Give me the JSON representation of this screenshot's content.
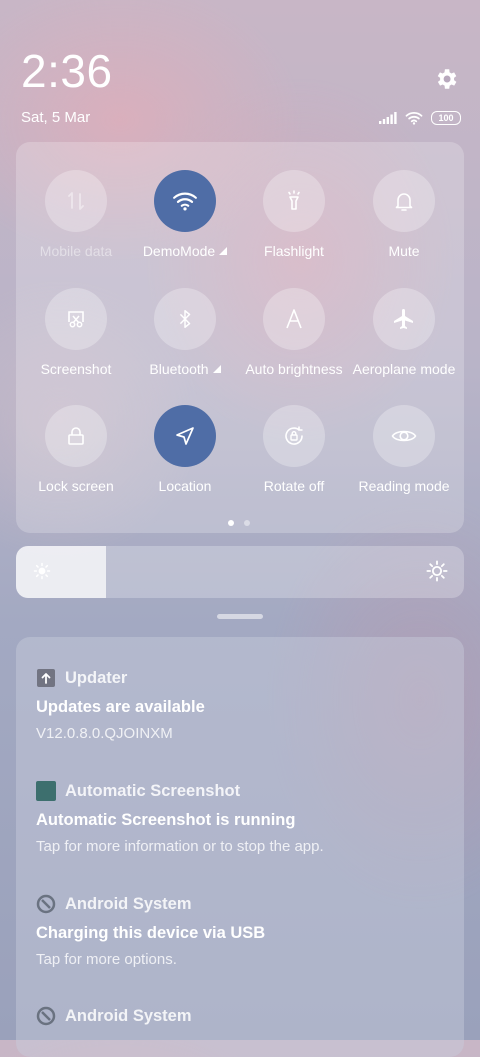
{
  "status_bar": {
    "time": "2:36",
    "date": "Sat, 5 Mar",
    "battery": "100",
    "icons": [
      "signal-icon",
      "wifi-icon",
      "battery-icon"
    ]
  },
  "quick_settings": {
    "tiles": [
      {
        "label": "Mobile data",
        "icon": "mobile-data-icon",
        "state": "disabled"
      },
      {
        "label": "DemoMode",
        "icon": "wifi-icon",
        "state": "active",
        "expandable": true
      },
      {
        "label": "Flashlight",
        "icon": "flashlight-icon",
        "state": "off"
      },
      {
        "label": "Mute",
        "icon": "bell-icon",
        "state": "off"
      },
      {
        "label": "Screenshot",
        "icon": "screenshot-icon",
        "state": "off"
      },
      {
        "label": "Bluetooth",
        "icon": "bluetooth-icon",
        "state": "off",
        "expandable": true
      },
      {
        "label": "Auto brightness",
        "icon": "auto-brightness-icon",
        "state": "off"
      },
      {
        "label": "Aeroplane mode",
        "icon": "airplane-icon",
        "state": "off"
      },
      {
        "label": "Lock screen",
        "icon": "lock-icon",
        "state": "off"
      },
      {
        "label": "Location",
        "icon": "location-icon",
        "state": "active"
      },
      {
        "label": "Rotate off",
        "icon": "rotate-lock-icon",
        "state": "off"
      },
      {
        "label": "Reading mode",
        "icon": "eye-icon",
        "state": "off"
      }
    ],
    "page_count": 2,
    "current_page": 1
  },
  "brightness": {
    "level_fraction": 0.2
  },
  "notifications": [
    {
      "app": "Updater",
      "icon": "upload-arrow-icon",
      "title": "Updates are available",
      "text": "V12.0.8.0.QJOINXM"
    },
    {
      "app": "Automatic Screenshot",
      "icon": "app-square-icon",
      "title": "Automatic Screenshot is running",
      "text": "Tap for more information or to stop the app."
    },
    {
      "app": "Android System",
      "icon": "android-system-icon",
      "title": "Charging this device via USB",
      "text": "Tap for more options."
    },
    {
      "app": "Android System",
      "icon": "android-system-icon",
      "title": "",
      "text": ""
    }
  ],
  "colors": {
    "active_tile": "#4f6da6",
    "app_square": "#3d6f6e"
  }
}
